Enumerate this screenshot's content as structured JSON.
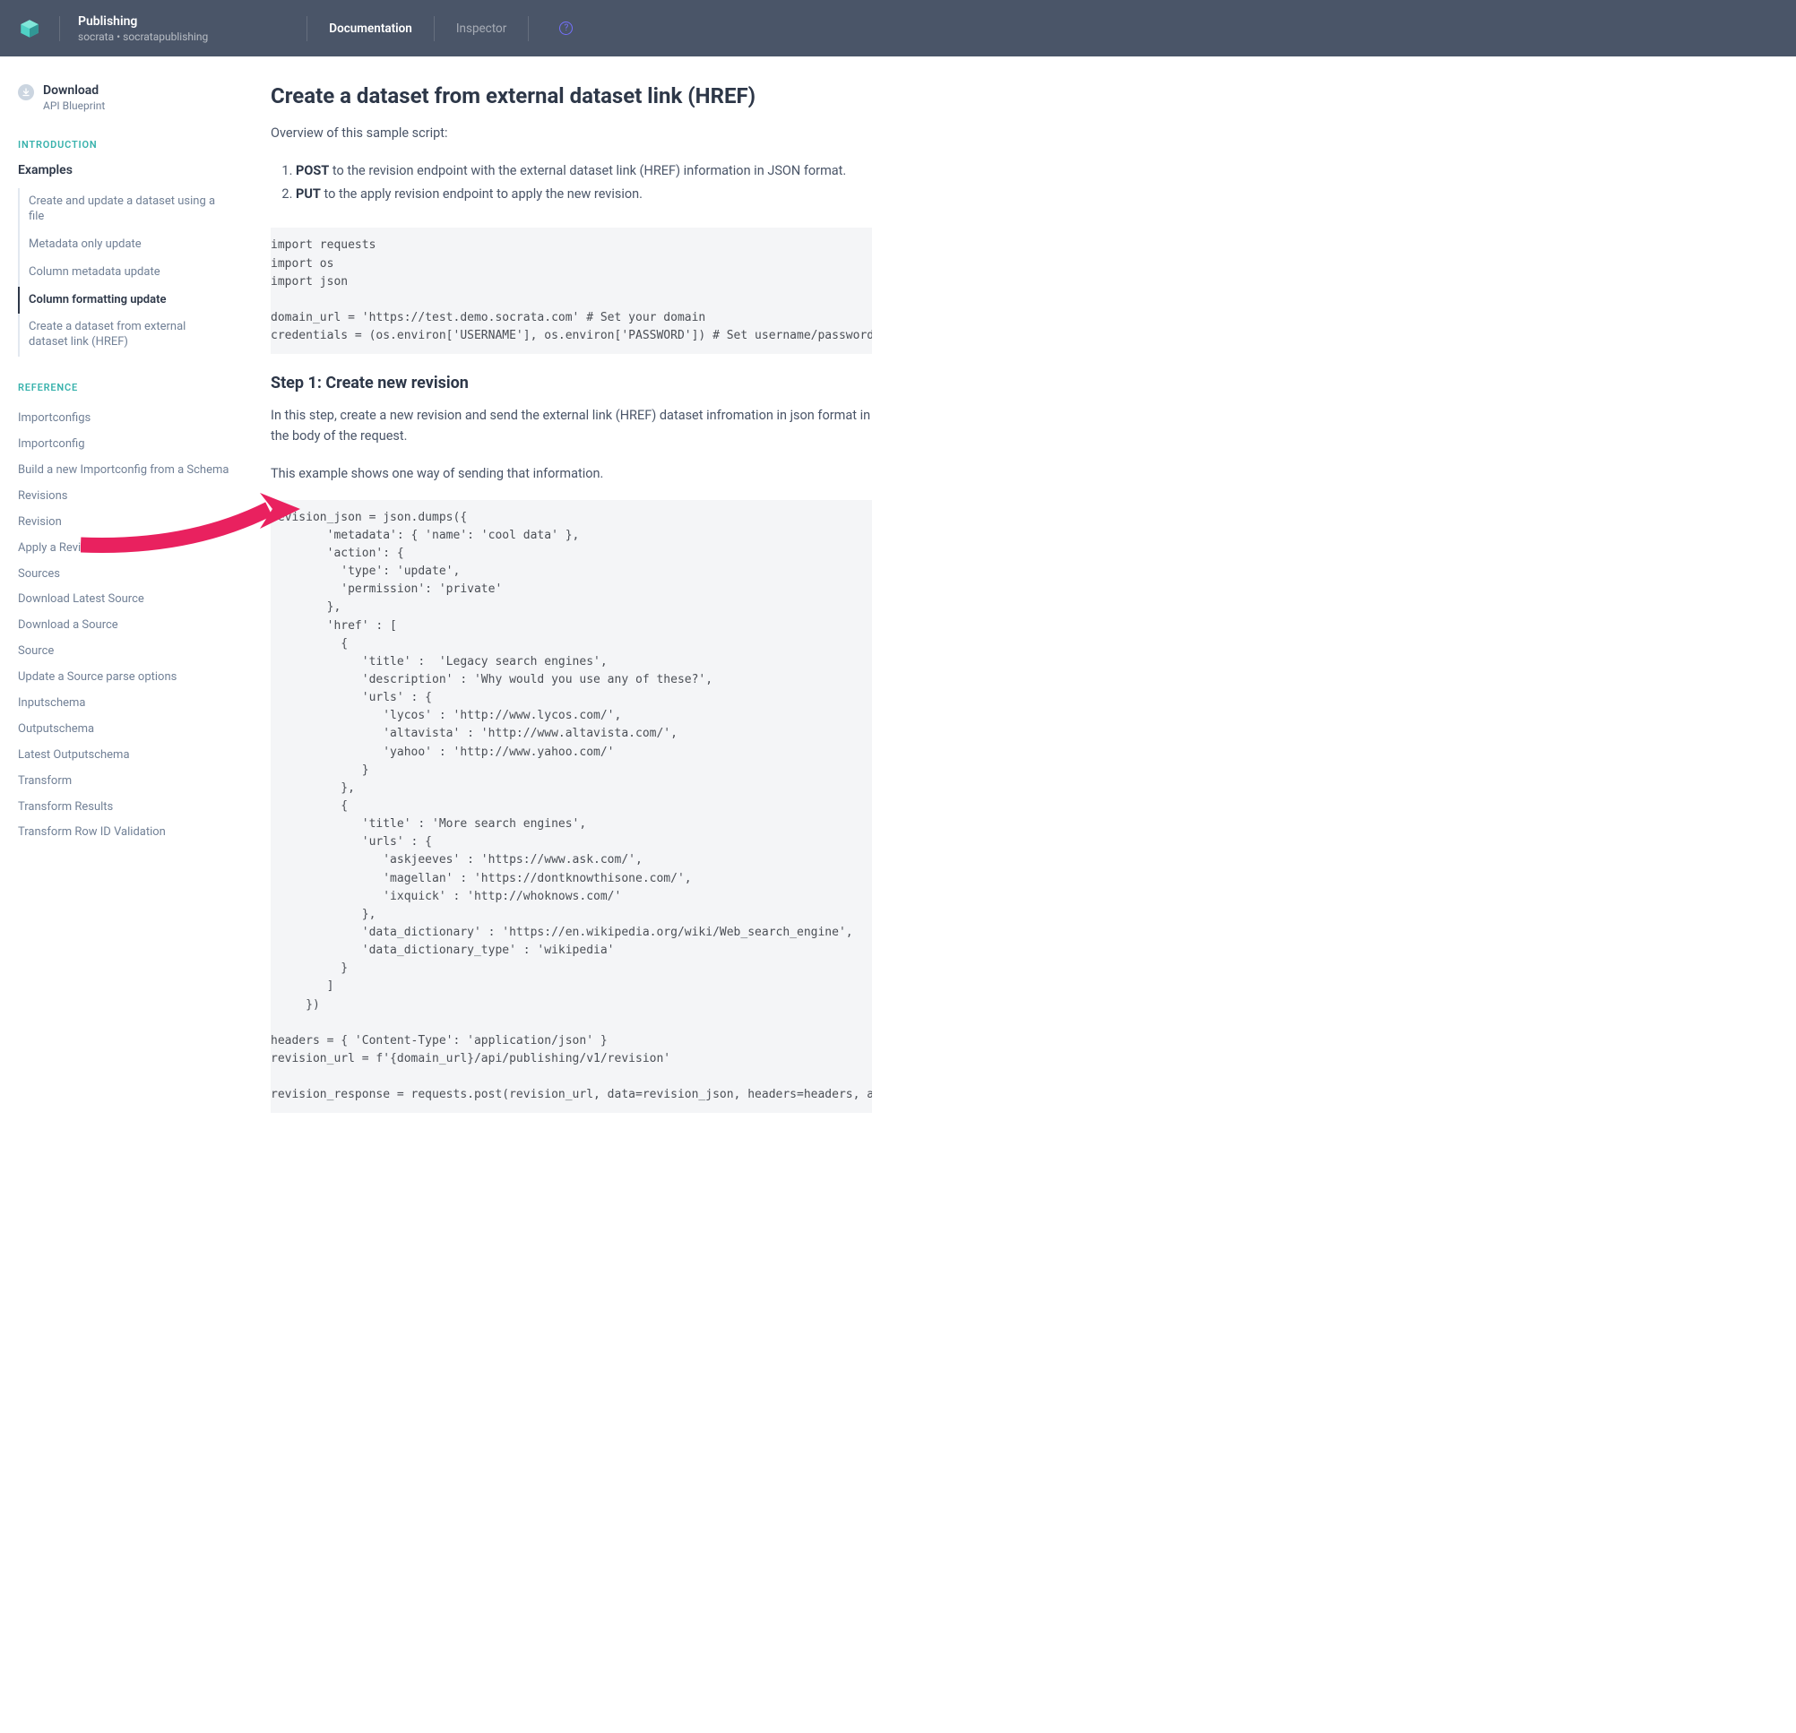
{
  "header": {
    "title": "Publishing",
    "sub": "socrata • socratapublishing",
    "nav": {
      "doc": "Documentation",
      "insp": "Inspector"
    }
  },
  "sidebar": {
    "download": {
      "title": "Download",
      "sub": "API Blueprint"
    },
    "intro_label": "INTRODUCTION",
    "examples_title": "Examples",
    "examples": [
      "Create and update a dataset using a file",
      "Metadata only update",
      "Column metadata update",
      "Column formatting update",
      "Create a dataset from external dataset link (HREF)"
    ],
    "ref_label": "REFERENCE",
    "reference": [
      "Importconfigs",
      "Importconfig",
      "Build a new Importconfig from a Schema",
      "Revisions",
      "Revision",
      "Apply a Revision",
      "Sources",
      "Download Latest Source",
      "Download a Source",
      "Source",
      "Update a Source parse options",
      "Inputschema",
      "Outputschema",
      "Latest Outputschema",
      "Transform",
      "Transform Results",
      "Transform Row ID Validation"
    ]
  },
  "main": {
    "title": "Create a dataset from external dataset link (HREF)",
    "overview": "Overview of this sample script:",
    "step1_b": "POST",
    "step1_t": " to the revision endpoint with the external dataset link (HREF) information in JSON format.",
    "step2_b": "PUT",
    "step2_t": " to the apply revision endpoint to apply the new revision.",
    "code1": "import requests\nimport os\nimport json\n\ndomain_url = 'https://test.demo.socrata.com' # Set your domain\ncredentials = (os.environ['USERNAME'], os.environ['PASSWORD']) # Set username/password that you use to update data on your Socrata site",
    "h2": "Step 1: Create new revision",
    "p1": "In this step, create a new revision and send the external link (HREF) dataset infromation in json format in the body of the request.",
    "p2": "This example shows one way of sending that information.",
    "code2": "revision_json = json.dumps({\n        'metadata': { 'name': 'cool data' },\n        'action': {\n          'type': 'update',\n          'permission': 'private'\n        },\n        'href' : [\n          {\n             'title' :  'Legacy search engines',\n             'description' : 'Why would you use any of these?',\n             'urls' : {\n                'lycos' : 'http://www.lycos.com/',\n                'altavista' : 'http://www.altavista.com/',\n                'yahoo' : 'http://www.yahoo.com/'\n             }\n          },\n          {\n             'title' : 'More search engines',\n             'urls' : {\n                'askjeeves' : 'https://www.ask.com/',\n                'magellan' : 'https://dontknowthisone.com/',\n                'ixquick' : 'http://whoknows.com/'\n             },\n             'data_dictionary' : 'https://en.wikipedia.org/wiki/Web_search_engine',\n             'data_dictionary_type' : 'wikipedia'\n          }\n        ]\n     })\n\nheaders = { 'Content-Type': 'application/json' }\nrevision_url = f'{domain_url}/api/publishing/v1/revision'\n\nrevision_response = requests.post(revision_url, data=revision_json, headers=headers, auth=credentials)"
  }
}
